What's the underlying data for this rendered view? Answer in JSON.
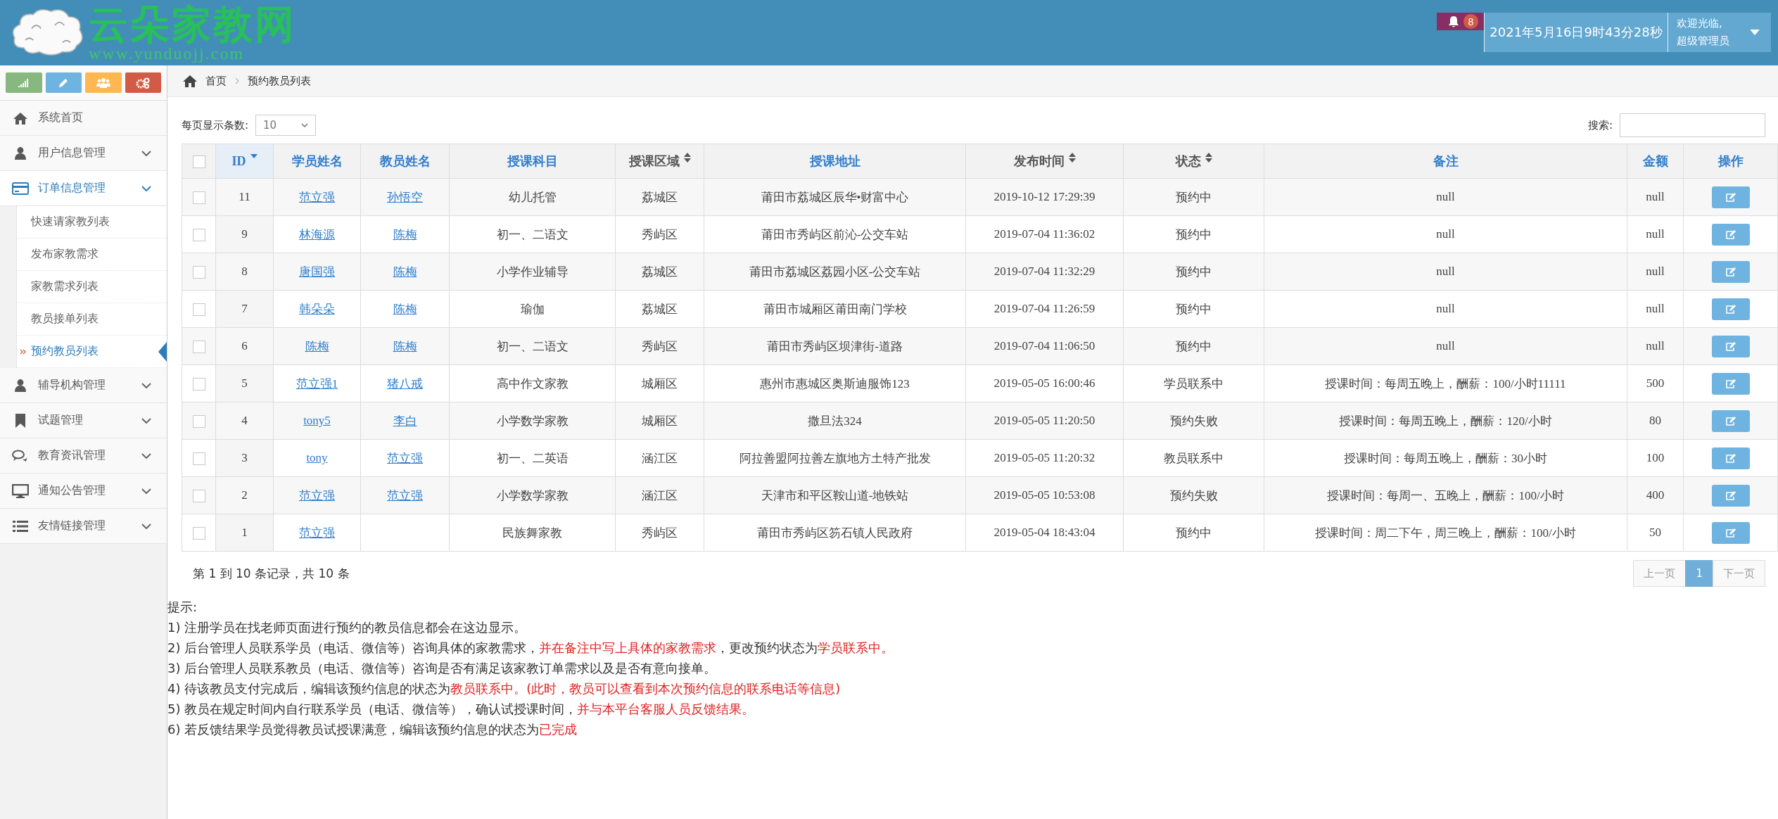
{
  "header": {
    "logo_title": "云朵家教网",
    "logo_url": "www.yunduojj.com",
    "notifications": "8",
    "datetime": "2021年5月16日9时43分28秒",
    "welcome": "欢迎光临,",
    "user": "超级管理员"
  },
  "shortcuts": [
    {
      "kind": "stats",
      "color": "#87b87f"
    },
    {
      "kind": "pencil",
      "color": "#6fb3e0"
    },
    {
      "kind": "users",
      "color": "#ffb752"
    },
    {
      "kind": "cogs",
      "color": "#d15b47"
    }
  ],
  "sidebar": {
    "items": [
      {
        "label": "系统首页",
        "kind": "home",
        "selected": false
      },
      {
        "label": "用户信息管理",
        "kind": "user",
        "expanded": false,
        "selected": false
      },
      {
        "label": "订单信息管理",
        "kind": "card",
        "expanded": true,
        "selected": true,
        "children": [
          {
            "label": "快速请家教列表",
            "selected": false
          },
          {
            "label": "发布家教需求",
            "selected": false
          },
          {
            "label": "家教需求列表",
            "selected": false
          },
          {
            "label": "教员接单列表",
            "selected": false
          },
          {
            "label": "预约教员列表",
            "selected": true
          }
        ]
      },
      {
        "label": "辅导机构管理",
        "kind": "user",
        "expanded": false,
        "selected": false
      },
      {
        "label": "试题管理",
        "kind": "bookmark",
        "expanded": false,
        "selected": false
      },
      {
        "label": "教育资讯管理",
        "kind": "comments",
        "expanded": false,
        "selected": false
      },
      {
        "label": "通知公告管理",
        "kind": "desktop",
        "expanded": false,
        "selected": false
      },
      {
        "label": "友情链接管理",
        "kind": "list",
        "expanded": false,
        "selected": false
      }
    ]
  },
  "breadcrumb": [
    "首页",
    "预约教员列表"
  ],
  "controls": {
    "page_size_label": "每页显示条数:",
    "page_size": "10",
    "search_label": "搜索:"
  },
  "table": {
    "select_all_checked": false,
    "columns": [
      {
        "label": "ID",
        "sortable": true,
        "sorted": true
      },
      {
        "label": "学员姓名",
        "sortable": false,
        "sorted": false
      },
      {
        "label": "教员姓名",
        "sortable": false,
        "sorted": false
      },
      {
        "label": "授课科目",
        "sortable": false,
        "sorted": false
      },
      {
        "label": "授课区域",
        "sortable": true,
        "sorted": false
      },
      {
        "label": "授课地址",
        "sortable": false,
        "sorted": false
      },
      {
        "label": "发布时间",
        "sortable": true,
        "sorted": false
      },
      {
        "label": "状态",
        "sortable": true,
        "sorted": false
      },
      {
        "label": "备注",
        "sortable": false,
        "sorted": false
      },
      {
        "label": "金额",
        "sortable": false,
        "sorted": false
      },
      {
        "label": "操作",
        "sortable": false,
        "sorted": false
      }
    ],
    "rows": [
      {
        "checked": false,
        "id": "11",
        "student": "范立强",
        "teacher": "孙悟空",
        "subject": "幼儿托管",
        "area": "荔城区",
        "address": "莆田市荔城区辰华•财富中心",
        "time": "2019-10-12 17:29:39",
        "status": "预约中",
        "note": "null",
        "amount": "null"
      },
      {
        "checked": false,
        "id": "9",
        "student": "林海源",
        "teacher": "陈梅",
        "subject": "初一、二语文",
        "area": "秀屿区",
        "address": "莆田市秀屿区前沁-公交车站",
        "time": "2019-07-04 11:36:02",
        "status": "预约中",
        "note": "null",
        "amount": "null"
      },
      {
        "checked": false,
        "id": "8",
        "student": "唐国强",
        "teacher": "陈梅",
        "subject": "小学作业辅导",
        "area": "荔城区",
        "address": "莆田市荔城区荔园小区-公交车站",
        "time": "2019-07-04 11:32:29",
        "status": "预约中",
        "note": "null",
        "amount": "null"
      },
      {
        "checked": false,
        "id": "7",
        "student": "韩朵朵",
        "teacher": "陈梅",
        "subject": "瑜伽",
        "area": "荔城区",
        "address": "莆田市城厢区莆田南门学校",
        "time": "2019-07-04 11:26:59",
        "status": "预约中",
        "note": "null",
        "amount": "null"
      },
      {
        "checked": false,
        "id": "6",
        "student": "陈梅",
        "teacher": "陈梅",
        "subject": "初一、二语文",
        "area": "秀屿区",
        "address": "莆田市秀屿区坝津街-道路",
        "time": "2019-07-04 11:06:50",
        "status": "预约中",
        "note": "null",
        "amount": "null"
      },
      {
        "checked": false,
        "id": "5",
        "student": "范立强1",
        "teacher": "猪八戒",
        "subject": "高中作文家教",
        "area": "城厢区",
        "address": "惠州市惠城区奥斯迪服饰123",
        "time": "2019-05-05 16:00:46",
        "status": "学员联系中",
        "note": "授课时间：每周五晚上，酬薪：100/小时11111",
        "amount": "500"
      },
      {
        "checked": false,
        "id": "4",
        "student": "tony5",
        "teacher": "李白",
        "subject": "小学数学家教",
        "area": "城厢区",
        "address": "撒旦法324",
        "time": "2019-05-05 11:20:50",
        "status": "预约失败",
        "note": "授课时间：每周五晚上，酬薪：120/小时",
        "amount": "80"
      },
      {
        "checked": false,
        "id": "3",
        "student": "tony",
        "teacher": "范立强",
        "subject": "初一、二英语",
        "area": "涵江区",
        "address": "阿拉善盟阿拉善左旗地方土特产批发",
        "time": "2019-05-05 11:20:32",
        "status": "教员联系中",
        "note": "授课时间：每周五晚上，酬薪：30小时",
        "amount": "100"
      },
      {
        "checked": false,
        "id": "2",
        "student": "范立强",
        "teacher": "范立强",
        "subject": "小学数学家教",
        "area": "涵江区",
        "address": "天津市和平区鞍山道-地铁站",
        "time": "2019-05-05 10:53:08",
        "status": "预约失败",
        "note": "授课时间：每周一、五晚上，酬薪：100/小时",
        "amount": "400"
      },
      {
        "checked": false,
        "id": "1",
        "student": "范立强",
        "subject": "民族舞家教",
        "area": "秀屿区",
        "address": "莆田市秀屿区笏石镇人民政府",
        "time": "2019-05-04 18:43:04",
        "status": "预约中",
        "note": "授课时间：周二下午，周三晚上，酬薪：100/小时",
        "amount": "50"
      }
    ]
  },
  "table_info": "第 1 到 10 条记录，共 10 条",
  "pagination": [
    {
      "label": "上一页",
      "selected": false,
      "disabled": true
    },
    {
      "label": "1",
      "selected": true,
      "disabled": false
    },
    {
      "label": "下一页",
      "selected": false,
      "disabled": true
    }
  ],
  "hints": {
    "title": "提示:",
    "lines": [
      [
        {
          "text": "1) 注册学员在找老师页面进行预约的教员信息都会在这边显示。",
          "red": false
        }
      ],
      [
        {
          "text": "2) 后台管理人员联系学员（电话、微信等）咨询具体的家教需求，",
          "red": false
        },
        {
          "text": "并在备注中写上具体的家教需求",
          "red": true
        },
        {
          "text": "，更改预约状态为",
          "red": false
        },
        {
          "text": "学员联系中。",
          "red": true
        }
      ],
      [
        {
          "text": "3) 后台管理人员联系教员（电话、微信等）咨询是否有满足该家教订单需求以及是否有意向接单。",
          "red": false
        }
      ],
      [
        {
          "text": "4) 待该教员支付完成后，编辑该预约信息的状态为",
          "red": false
        },
        {
          "text": "教员联系中。(此时，教员可以查看到本次预约信息的联系电话等信息)",
          "red": true
        }
      ],
      [
        {
          "text": "5) 教员在规定时间内自行联系学员（电话、微信等），确认试授课时间，",
          "red": false
        },
        {
          "text": "并与本平台客服人员反馈结果。",
          "red": true
        }
      ],
      [
        {
          "text": "6) 若反馈结果学员觉得教员试授课满意，编辑该预约信息的状态为",
          "red": false
        },
        {
          "text": "已完成",
          "red": true
        }
      ]
    ]
  }
}
